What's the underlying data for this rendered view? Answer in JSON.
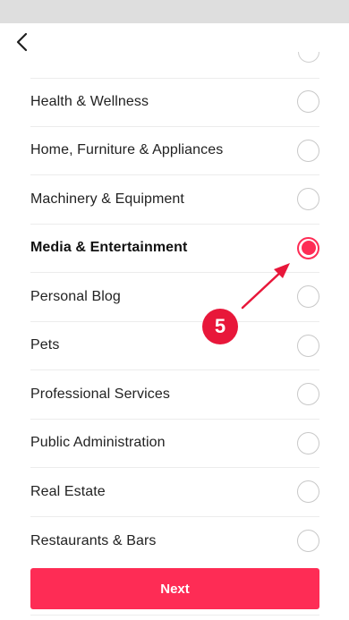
{
  "colors": {
    "accent": "#fe2c55",
    "annotation": "#e8173a",
    "status_bar": "#dedede",
    "divider": "#ececec"
  },
  "nav": {
    "back_icon": "chevron-left-icon"
  },
  "categories": [
    {
      "label": "Health & Wellness",
      "selected": false
    },
    {
      "label": "Home, Furniture & Appliances",
      "selected": false
    },
    {
      "label": "Machinery & Equipment",
      "selected": false
    },
    {
      "label": "Media & Entertainment",
      "selected": true
    },
    {
      "label": "Personal Blog",
      "selected": false
    },
    {
      "label": "Pets",
      "selected": false
    },
    {
      "label": "Professional Services",
      "selected": false
    },
    {
      "label": "Public Administration",
      "selected": false
    },
    {
      "label": "Real Estate",
      "selected": false
    },
    {
      "label": "Restaurants & Bars",
      "selected": false
    }
  ],
  "next_label": "Next",
  "annotation": {
    "step_number": "5"
  }
}
